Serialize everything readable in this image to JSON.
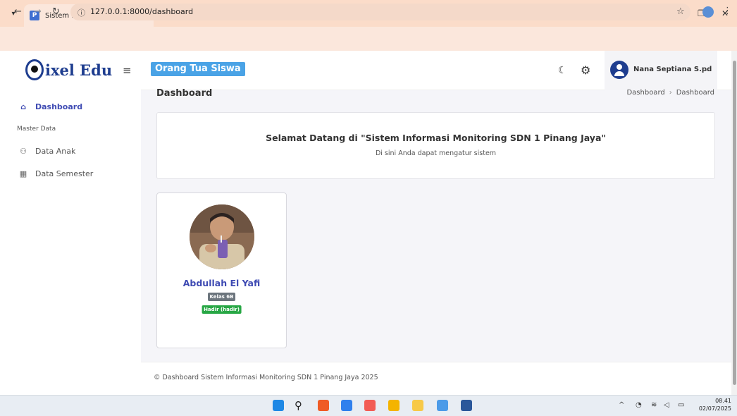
{
  "browser": {
    "tab_title": "Sistem Informasi Monitoring SD",
    "url": "127.0.0.1:8000/dashboard",
    "new_tab": "+",
    "close_tab": "×"
  },
  "app": {
    "brand": "ixel Edu",
    "role": "Orang Tua Siswa"
  },
  "sidebar": {
    "items": [
      {
        "label": "Dashboard",
        "icon": "home-icon"
      },
      {
        "label": "Data Anak",
        "icon": "users-icon"
      },
      {
        "label": "Data Semester",
        "icon": "calendar-icon"
      }
    ],
    "section": "Master Data"
  },
  "user": {
    "name": "Nana Septiana S.pd"
  },
  "page": {
    "title": "Dashboard",
    "breadcrumb": [
      "Dashboard",
      "Dashboard"
    ]
  },
  "welcome": {
    "title": "Selamat Datang di \"Sistem Informasi Monitoring SDN 1 Pinang Jaya\"",
    "subtitle": "Di sini Anda dapat mengatur sistem"
  },
  "student": {
    "name": "Abdullah El Yafi",
    "class": "Kelas 6B",
    "status": "Hadir (hadir)"
  },
  "footer": {
    "text": "© Dashboard Sistem Informasi Monitoring SDN 1 Pinang Jaya 2025"
  },
  "taskbar": {
    "time": "08.41",
    "date": "02/07/2025"
  },
  "colors": {
    "accent": "#3f4bb3",
    "role_badge": "#4aa3e6",
    "status_green": "#28a745"
  }
}
